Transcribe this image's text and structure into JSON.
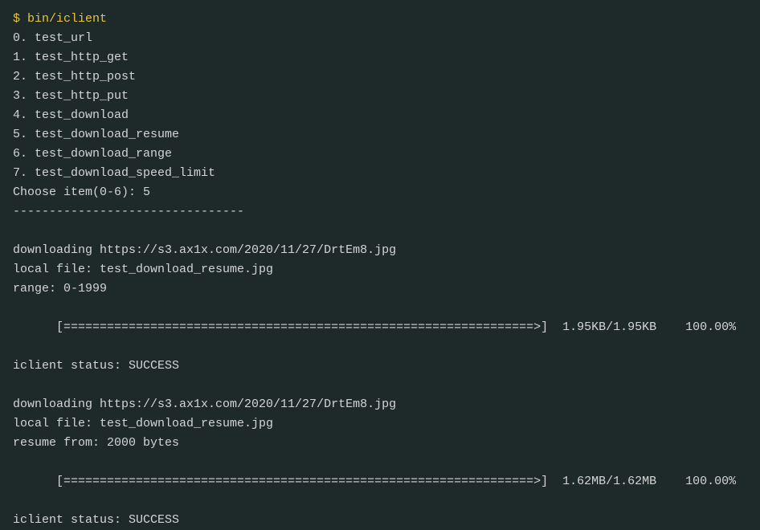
{
  "terminal": {
    "prompt": "$ bin/iclient",
    "menu": [
      "0. test_url",
      "1. test_http_get",
      "2. test_http_post",
      "3. test_http_put",
      "4. test_download",
      "5. test_download_resume",
      "6. test_download_range",
      "7. test_download_speed_limit"
    ],
    "choose_prompt": "Choose item(0-6): 5",
    "separator": "--------------------------------",
    "block1": {
      "line1": "downloading https://s3.ax1x.com/2020/11/27/DrtEm8.jpg",
      "line2": "local file: test_download_resume.jpg",
      "line3": "range: 0-1999",
      "progress": "[=================================================================>]",
      "progress_stats": "  1.95KB/1.95KB    100.00%",
      "status": "iclient status: SUCCESS"
    },
    "block2": {
      "line1": "downloading https://s3.ax1x.com/2020/11/27/DrtEm8.jpg",
      "line2": "local file: test_download_resume.jpg",
      "line3": "resume from: 2000 bytes",
      "progress": "[=================================================================>]",
      "progress_stats": "  1.62MB/1.62MB    100.00%",
      "status": "iclient status: SUCCESS"
    }
  }
}
